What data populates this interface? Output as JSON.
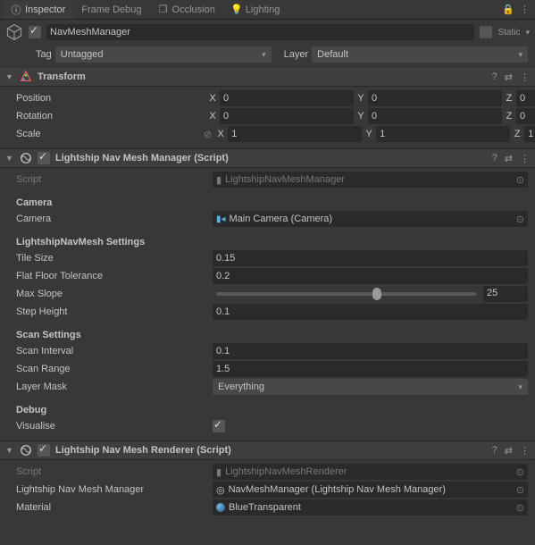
{
  "tabs": {
    "inspector": "Inspector",
    "frame_debug": "Frame Debug",
    "occlusion": "Occlusion",
    "lighting": "Lighting"
  },
  "header": {
    "name": "NavMeshManager",
    "static_label": "Static",
    "tag_label": "Tag",
    "tag_value": "Untagged",
    "layer_label": "Layer",
    "layer_value": "Default"
  },
  "transform": {
    "title": "Transform",
    "position_label": "Position",
    "rotation_label": "Rotation",
    "scale_label": "Scale",
    "x": "X",
    "y": "Y",
    "z": "Z",
    "pos": {
      "x": "0",
      "y": "0",
      "z": "0"
    },
    "rot": {
      "x": "0",
      "y": "0",
      "z": "0"
    },
    "scale": {
      "x": "1",
      "y": "1",
      "z": "1"
    }
  },
  "manager": {
    "title": "Lightship Nav Mesh Manager (Script)",
    "script_label": "Script",
    "script_value": "LightshipNavMeshManager",
    "camera_header": "Camera",
    "camera_label": "Camera",
    "camera_value": "Main Camera (Camera)",
    "settings_header": "LightshipNavMesh Settings",
    "tile_size_label": "Tile Size",
    "tile_size_value": "0.15",
    "flat_floor_label": "Flat Floor Tolerance",
    "flat_floor_value": "0.2",
    "max_slope_label": "Max Slope",
    "max_slope_value": "25",
    "max_slope_pct": 62,
    "step_height_label": "Step Height",
    "step_height_value": "0.1",
    "scan_header": "Scan Settings",
    "scan_interval_label": "Scan Interval",
    "scan_interval_value": "0.1",
    "scan_range_label": "Scan Range",
    "scan_range_value": "1.5",
    "layer_mask_label": "Layer Mask",
    "layer_mask_value": "Everything",
    "debug_header": "Debug",
    "visualise_label": "Visualise"
  },
  "renderer": {
    "title": "Lightship Nav Mesh Renderer (Script)",
    "script_label": "Script",
    "script_value": "LightshipNavMeshRenderer",
    "manager_label": "Lightship Nav Mesh Manager",
    "manager_value": "NavMeshManager (Lightship Nav Mesh Manager)",
    "material_label": "Material",
    "material_value": "BlueTransparent"
  }
}
